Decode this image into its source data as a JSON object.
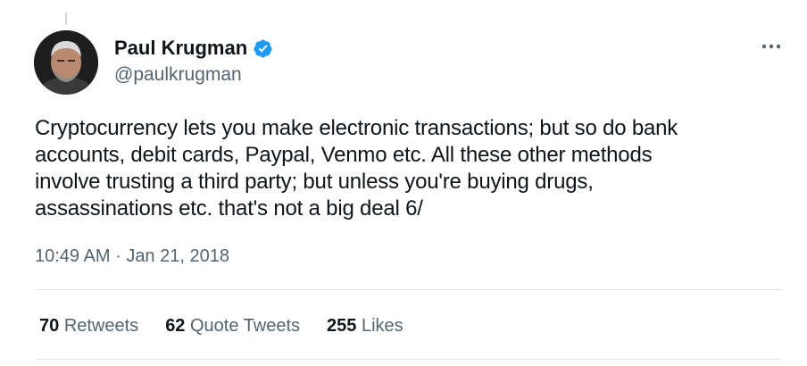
{
  "tweet": {
    "author": {
      "display_name": "Paul Krugman",
      "handle": "@paulkrugman",
      "verified": true,
      "avatar_icon": "avatar-photo"
    },
    "text": "Cryptocurrency lets you make electronic transactions; but so do bank\naccounts, debit cards, Paypal, Venmo etc. All these other methods\ninvolve trusting a third party; but unless you're buying drugs,\nassassinations etc. that's not a big deal 6/",
    "time": "10:49 AM",
    "separator": "·",
    "date": "Jan 21, 2018",
    "more_icon": "more-horizontal-icon",
    "stats": {
      "retweets_count": "70",
      "retweets_label": "Retweets",
      "quotes_count": "62",
      "quotes_label": "Quote Tweets",
      "likes_count": "255",
      "likes_label": "Likes"
    }
  },
  "colors": {
    "text_primary": "#0f1419",
    "text_secondary": "#536471",
    "verified_blue": "#1d9bf0",
    "divider": "#e4e9ec"
  }
}
